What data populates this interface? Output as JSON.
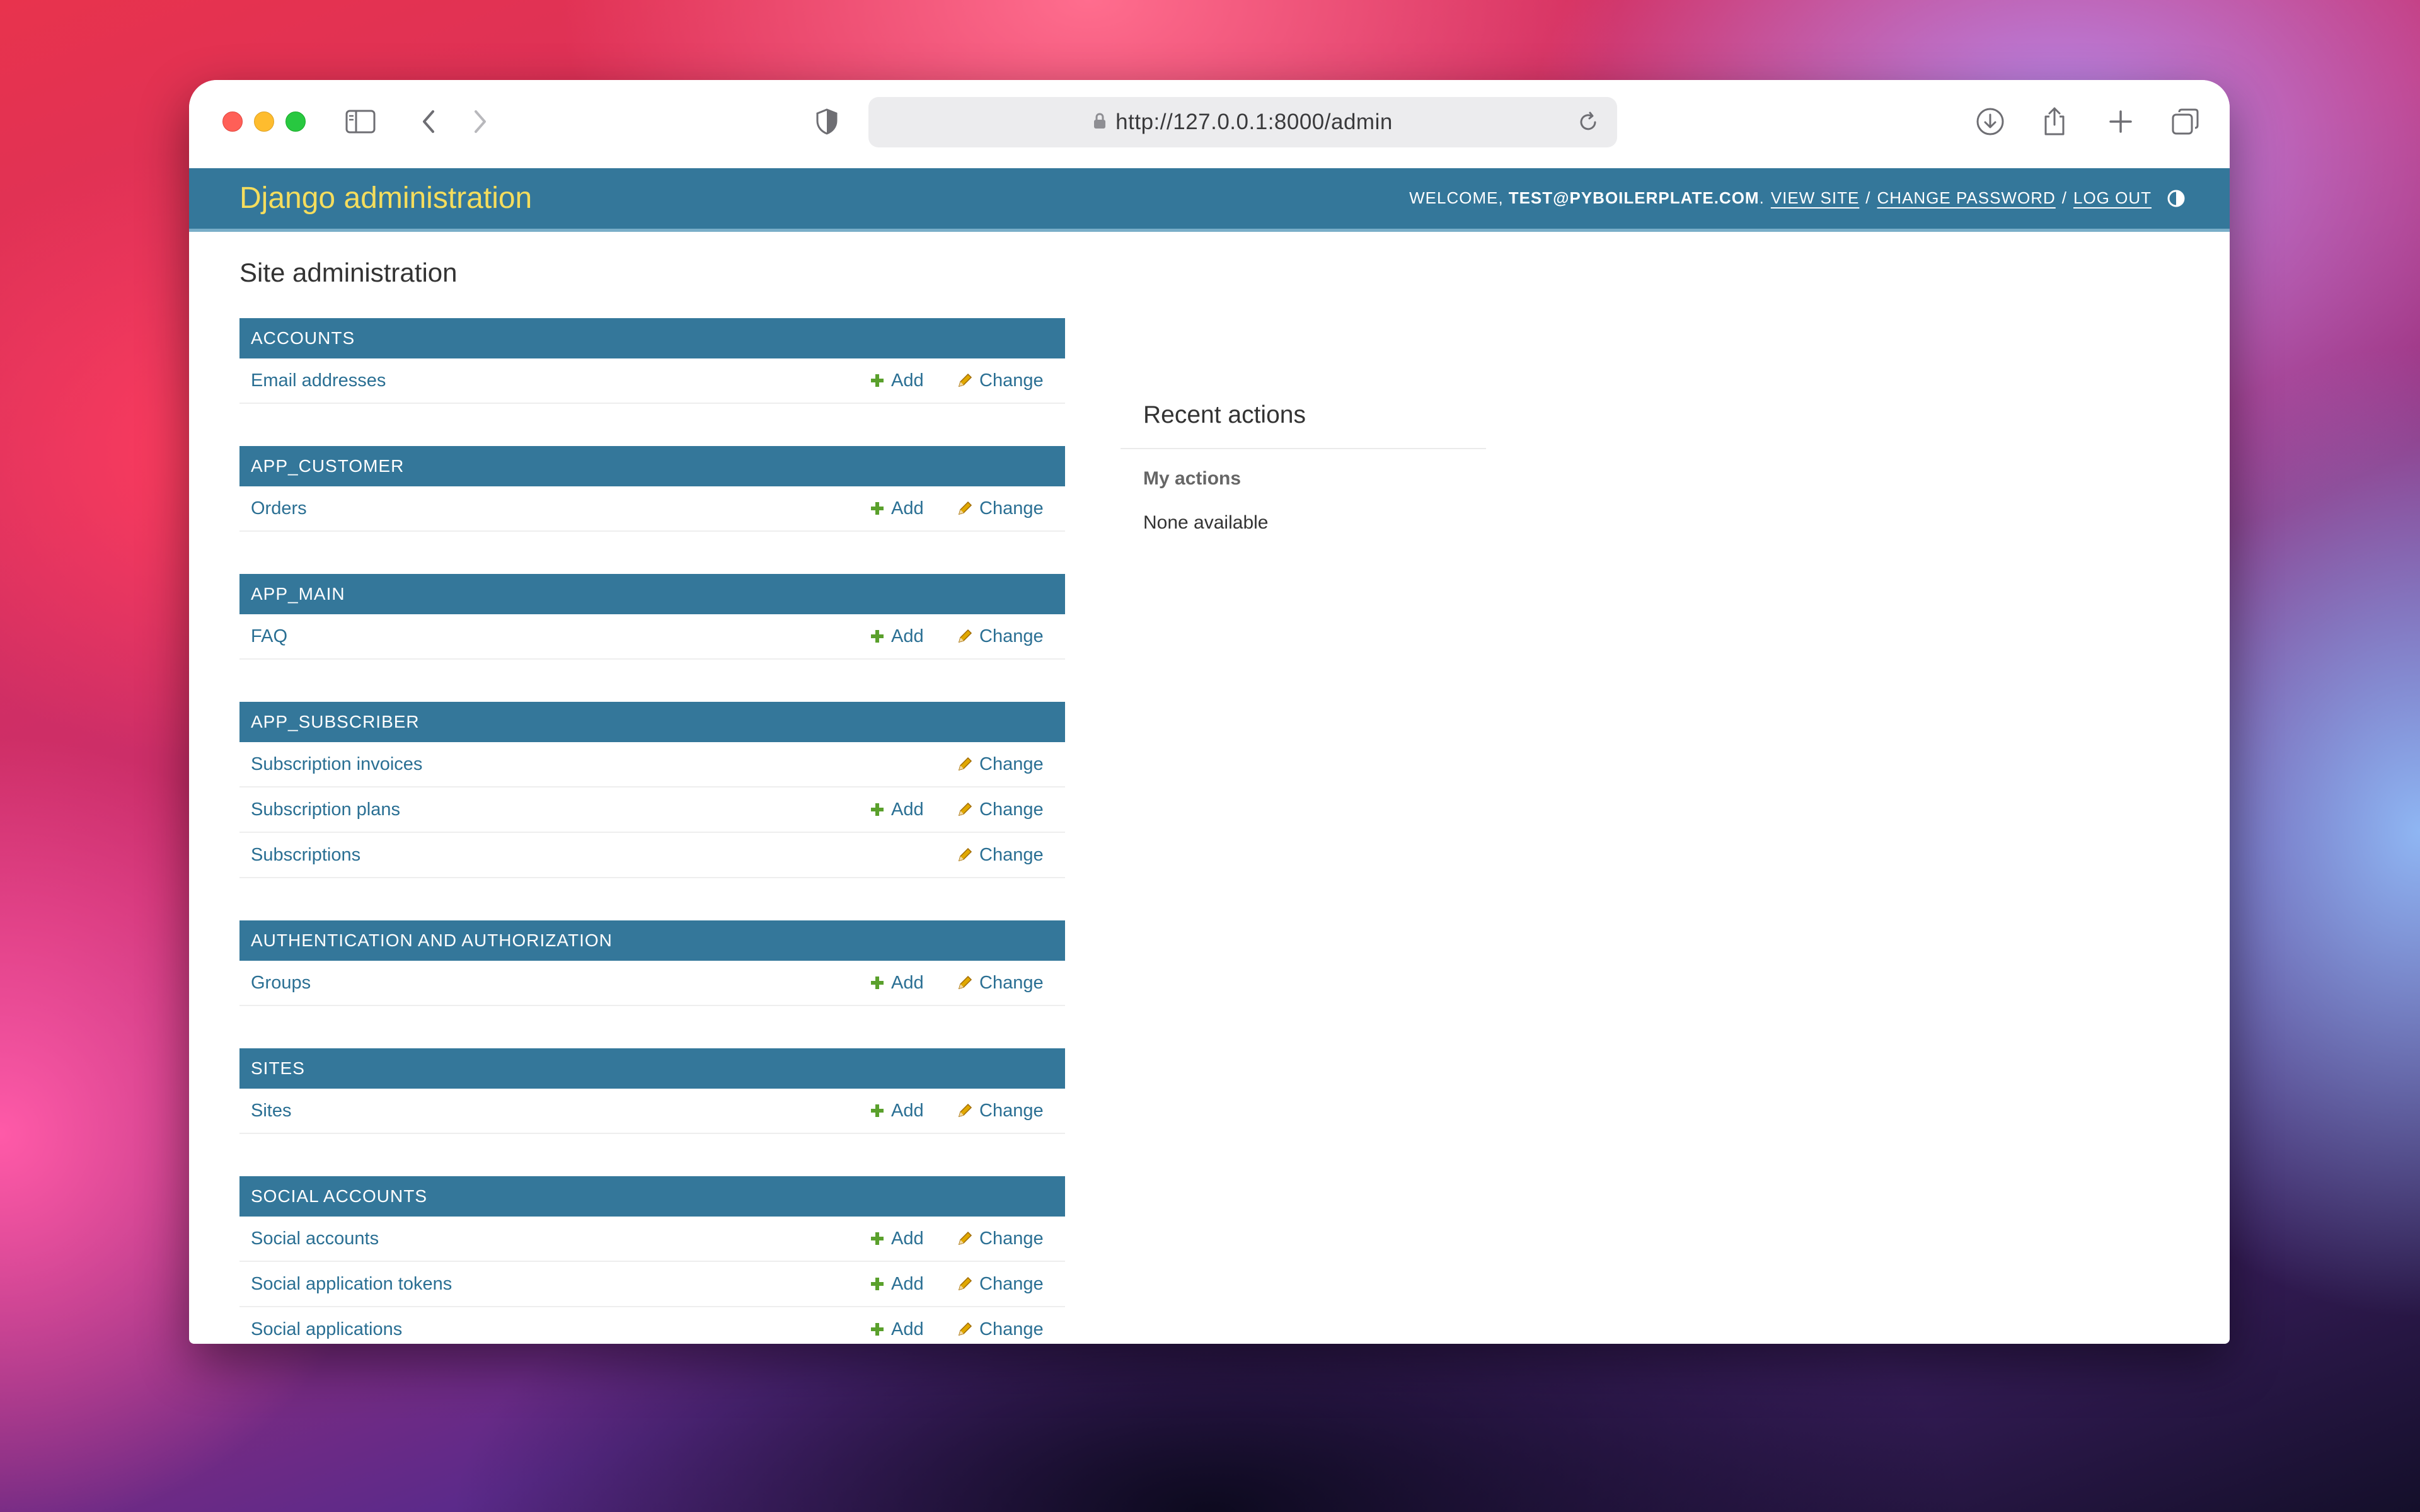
{
  "browser": {
    "url": "http://127.0.0.1:8000/admin"
  },
  "header": {
    "branding": "Django administration",
    "welcome": "WELCOME,",
    "user": "TEST@PYBOILERPLATE.COM",
    "user_suffix": ".",
    "view_site": "VIEW SITE",
    "change_password": "CHANGE PASSWORD",
    "log_out": "LOG OUT",
    "separator": "/"
  },
  "page_title": "Site administration",
  "modules": [
    {
      "caption": "ACCOUNTS",
      "models": [
        {
          "name": "Email addresses",
          "add": "Add",
          "change": "Change"
        }
      ]
    },
    {
      "caption": "APP_CUSTOMER",
      "models": [
        {
          "name": "Orders",
          "add": "Add",
          "change": "Change"
        }
      ]
    },
    {
      "caption": "APP_MAIN",
      "models": [
        {
          "name": "FAQ",
          "add": "Add",
          "change": "Change"
        }
      ]
    },
    {
      "caption": "APP_SUBSCRIBER",
      "models": [
        {
          "name": "Subscription invoices",
          "add": "",
          "change": "Change"
        },
        {
          "name": "Subscription plans",
          "add": "Add",
          "change": "Change"
        },
        {
          "name": "Subscriptions",
          "add": "",
          "change": "Change"
        }
      ]
    },
    {
      "caption": "AUTHENTICATION AND AUTHORIZATION",
      "models": [
        {
          "name": "Groups",
          "add": "Add",
          "change": "Change"
        }
      ]
    },
    {
      "caption": "SITES",
      "models": [
        {
          "name": "Sites",
          "add": "Add",
          "change": "Change"
        }
      ]
    },
    {
      "caption": "SOCIAL ACCOUNTS",
      "models": [
        {
          "name": "Social accounts",
          "add": "Add",
          "change": "Change"
        },
        {
          "name": "Social application tokens",
          "add": "Add",
          "change": "Change"
        },
        {
          "name": "Social applications",
          "add": "Add",
          "change": "Change"
        }
      ]
    }
  ],
  "recent_actions": {
    "title": "Recent actions",
    "subtitle": "My actions",
    "empty": "None available"
  },
  "colors": {
    "header_bg": "#34779a",
    "branding": "#f5dd5d",
    "link": "#2a6f93",
    "add_icon": "#5aa02c",
    "change_icon": "#e0a800"
  },
  "icons": [
    "sidebar-icon",
    "back-icon",
    "forward-icon",
    "shield-icon",
    "lock-icon",
    "reload-icon",
    "download-icon",
    "share-icon",
    "new-tab-icon",
    "tabs-overview-icon",
    "theme-toggle-icon",
    "add-icon",
    "change-icon"
  ]
}
